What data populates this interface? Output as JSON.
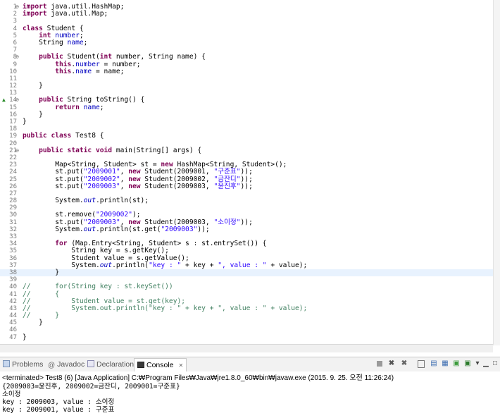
{
  "editor": {
    "lines": [
      {
        "n": "1",
        "marker": "fold",
        "html": "<span class=\"kw\">import</span> java.util.HashMap;"
      },
      {
        "n": "2",
        "html": "<span class=\"kw\">import</span> java.util.Map;"
      },
      {
        "n": "3",
        "html": ""
      },
      {
        "n": "4",
        "html": "<span class=\"kw\">class</span> Student {"
      },
      {
        "n": "5",
        "html": "    <span class=\"kw\">int</span> <span class=\"fld\">number</span>;"
      },
      {
        "n": "6",
        "html": "    String <span class=\"fld\">name</span>;"
      },
      {
        "n": "7",
        "html": ""
      },
      {
        "n": "8",
        "marker": "fold",
        "html": "    <span class=\"kw\">public</span> Student(<span class=\"kw\">int</span> number, String name) {"
      },
      {
        "n": "9",
        "html": "        <span class=\"kw\">this</span>.<span class=\"fld\">number</span> = number;"
      },
      {
        "n": "10",
        "html": "        <span class=\"kw\">this</span>.<span class=\"fld\">name</span> = name;"
      },
      {
        "n": "11",
        "html": ""
      },
      {
        "n": "12",
        "html": "    }"
      },
      {
        "n": "13",
        "html": ""
      },
      {
        "n": "14",
        "marker": "override",
        "html": "    <span class=\"kw\">public</span> String toString() {"
      },
      {
        "n": "15",
        "html": "        <span class=\"kw\">return</span> <span class=\"fld\">name</span>;"
      },
      {
        "n": "16",
        "html": "    }"
      },
      {
        "n": "17",
        "html": "}"
      },
      {
        "n": "18",
        "html": ""
      },
      {
        "n": "19",
        "html": "<span class=\"kw\">public</span> <span class=\"kw\">class</span> Test8 {"
      },
      {
        "n": "20",
        "html": ""
      },
      {
        "n": "21",
        "marker": "fold",
        "html": "    <span class=\"kw\">public</span> <span class=\"kw\">static</span> <span class=\"kw\">void</span> main(String[] args) {"
      },
      {
        "n": "22",
        "html": ""
      },
      {
        "n": "23",
        "html": "        Map&lt;String, Student&gt; st = <span class=\"kw\">new</span> HashMap&lt;String, Student&gt;();"
      },
      {
        "n": "24",
        "html": "        st.put(<span class=\"str\">\"2009001\"</span>, <span class=\"kw\">new</span> Student(2009001, <span class=\"str\">\"구준표\"</span>));"
      },
      {
        "n": "25",
        "html": "        st.put(<span class=\"str\">\"2009002\"</span>, <span class=\"kw\">new</span> Student(2009002, <span class=\"str\">\"금잔디\"</span>));"
      },
      {
        "n": "26",
        "html": "        st.put(<span class=\"str\">\"2009003\"</span>, <span class=\"kw\">new</span> Student(2009003, <span class=\"str\">\"윤진후\"</span>));"
      },
      {
        "n": "27",
        "html": ""
      },
      {
        "n": "28",
        "html": "        System.<span class=\"sf\">out</span>.println(st);"
      },
      {
        "n": "29",
        "html": ""
      },
      {
        "n": "30",
        "html": "        st.remove(<span class=\"str\">\"2009002\"</span>);"
      },
      {
        "n": "31",
        "html": "        st.put(<span class=\"str\">\"2009003\"</span>, <span class=\"kw\">new</span> Student(2009003, <span class=\"str\">\"소이정\"</span>));"
      },
      {
        "n": "32",
        "html": "        System.<span class=\"sf\">out</span>.println(st.get(<span class=\"str\">\"2009003\"</span>));"
      },
      {
        "n": "33",
        "html": ""
      },
      {
        "n": "34",
        "html": "        <span class=\"kw\">for</span> (Map.Entry&lt;String, Student&gt; s : st.entrySet()) {"
      },
      {
        "n": "35",
        "html": "            String key = s.getKey();"
      },
      {
        "n": "36",
        "html": "            Student value = s.getValue();"
      },
      {
        "n": "37",
        "html": "            System.<span class=\"sf\">out</span>.println(<span class=\"str\">\"key : \"</span> + key + <span class=\"str\">\", value : \"</span> + value);"
      },
      {
        "n": "38",
        "current": true,
        "html": "        }"
      },
      {
        "n": "39",
        "html": ""
      },
      {
        "n": "40",
        "html": "<span class=\"cm\">//      for(String key : st.keySet())</span>"
      },
      {
        "n": "41",
        "html": "<span class=\"cm\">//      {</span>"
      },
      {
        "n": "42",
        "html": "<span class=\"cm\">//          Student value = st.get(key);</span>"
      },
      {
        "n": "43",
        "html": "<span class=\"cm\">//          System.out.println(\"key : \" + key + \", value : \" + value);</span>"
      },
      {
        "n": "44",
        "html": "<span class=\"cm\">//      }</span>"
      },
      {
        "n": "45",
        "html": "    }"
      },
      {
        "n": "46",
        "html": ""
      },
      {
        "n": "47",
        "html": "}"
      }
    ]
  },
  "views": {
    "tabs": [
      {
        "label": "Problems",
        "icon": "problems-icon",
        "active": false
      },
      {
        "label": "Javadoc",
        "icon": "javadoc-icon",
        "active": false
      },
      {
        "label": "Declaration",
        "icon": "declaration-icon",
        "active": false
      },
      {
        "label": "Console",
        "icon": "console-icon",
        "active": true
      }
    ],
    "close_glyph": "✕",
    "toolbar_icons": [
      "terminate-icon",
      "remove-launch-icon",
      "remove-all-icon",
      "clear-console-icon",
      "scroll-lock-icon",
      "word-wrap-icon",
      "pin-console-icon",
      "display-console-icon",
      "open-console-icon",
      "minimize-icon",
      "maximize-icon"
    ]
  },
  "console": {
    "status": "<terminated> Test8 (6) [Java Application] C:₩Program Files₩Java₩jre1.8.0_60₩bin₩javaw.exe (2015. 9. 25. 오전 11:26:24)",
    "output": [
      "{2009003=윤진후, 2009002=금잔디, 2009001=구준표}",
      "소이정",
      "key : 2009003, value : 소이정",
      "key : 2009001, value : 구준표"
    ]
  }
}
